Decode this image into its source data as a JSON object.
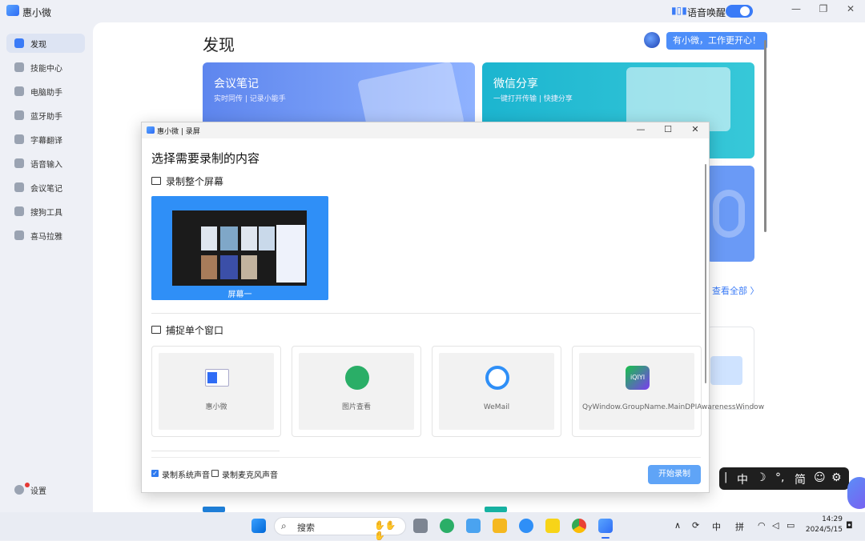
{
  "app": {
    "title": "惠小微",
    "voice_wake_label": "语音唤醒",
    "voice_wake_on": true,
    "window_controls": {
      "minimize": "—",
      "maximize": "❐",
      "close": "✕"
    }
  },
  "sidebar": {
    "items": [
      {
        "label": "发现",
        "active": true
      },
      {
        "label": "技能中心"
      },
      {
        "label": "电脑助手"
      },
      {
        "label": "蓝牙助手"
      },
      {
        "label": "字幕翻译"
      },
      {
        "label": "语音输入"
      },
      {
        "label": "会议笔记"
      },
      {
        "label": "搜狗工具"
      },
      {
        "label": "喜马拉雅"
      }
    ],
    "settings_label": "设置"
  },
  "main": {
    "title": "发现",
    "assistant_bubble": "有小微，工作更开心！",
    "cards": [
      {
        "title": "会议笔记",
        "subtitle": "实时同传 | 记录小能手"
      },
      {
        "title": "微信分享",
        "subtitle": "一键打开传输 | 快捷分享"
      }
    ],
    "view_all": "查看全部 〉"
  },
  "dialog": {
    "title": "惠小微 | 录屏",
    "heading": "选择需要录制的内容",
    "section_screen": "录制整个屏幕",
    "screen_label": "屏幕一",
    "section_window": "捕捉单个窗口",
    "windows": [
      {
        "label": "惠小微",
        "icon": "app-window-icon",
        "color": "#2f6cf5"
      },
      {
        "label": "图片查看",
        "icon": "wechat-icon",
        "color": "#2aae67"
      },
      {
        "label": "WeMail",
        "icon": "wemail-icon",
        "color": "#2f8ff7"
      },
      {
        "label": "QyWindow.GroupName.MainDPIAwarenessWindow",
        "icon": "iqiyi-icon",
        "color": "#18c24b"
      }
    ],
    "checkbox_system_audio": {
      "label": "录制系统声音",
      "checked": true
    },
    "checkbox_mic_audio": {
      "label": "录制麦克风声音",
      "checked": false
    },
    "start_button": "开始录制"
  },
  "ime": {
    "items": [
      "中",
      "简"
    ]
  },
  "taskbar": {
    "search_placeholder": "搜索",
    "tray_ime_1": "中",
    "tray_ime_2": "拼",
    "time": "14:29",
    "date": "2024/5/15"
  }
}
